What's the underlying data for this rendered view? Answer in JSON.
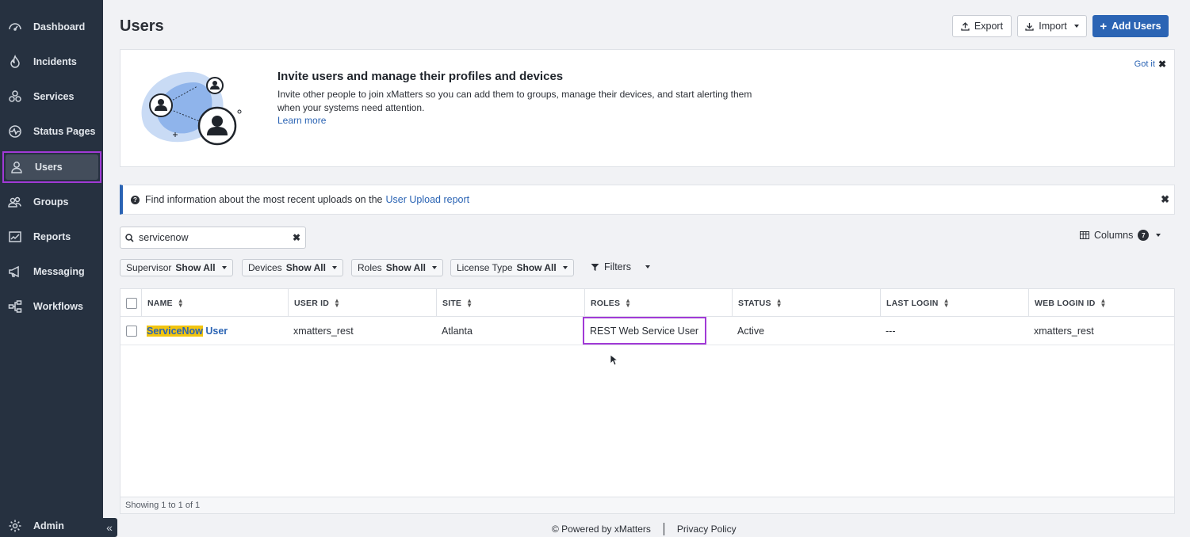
{
  "sidebar": {
    "items": [
      {
        "label": "Dashboard",
        "icon": "dashboard-icon"
      },
      {
        "label": "Incidents",
        "icon": "flame-icon"
      },
      {
        "label": "Services",
        "icon": "services-icon"
      },
      {
        "label": "Status Pages",
        "icon": "status-icon"
      },
      {
        "label": "Users",
        "icon": "user-icon",
        "active": true
      },
      {
        "label": "Groups",
        "icon": "groups-icon"
      },
      {
        "label": "Reports",
        "icon": "chart-icon"
      },
      {
        "label": "Messaging",
        "icon": "megaphone-icon"
      },
      {
        "label": "Workflows",
        "icon": "workflow-icon"
      }
    ],
    "admin_label": "Admin",
    "collapse_glyph": "«"
  },
  "header": {
    "title": "Users",
    "export_label": "Export",
    "import_label": "Import",
    "add_users_label": "Add Users"
  },
  "invite": {
    "title": "Invite users and manage their profiles and devices",
    "description": "Invite other people to join xMatters so you can add them to groups, manage their devices, and start alerting them when your systems need attention.",
    "learn_more": "Learn more",
    "got_it": "Got it"
  },
  "banner": {
    "text": "Find information about the most recent uploads on the",
    "link": "User Upload report"
  },
  "search": {
    "value": "servicenow",
    "placeholder": "Search"
  },
  "columns_label": "Columns",
  "columns_badge": "7",
  "filters": [
    {
      "label": "Supervisor",
      "value": "Show All"
    },
    {
      "label": "Devices",
      "value": "Show All"
    },
    {
      "label": "Roles",
      "value": "Show All"
    },
    {
      "label": "License Type",
      "value": "Show All"
    }
  ],
  "filters_label": "Filters",
  "table": {
    "headers": [
      "NAME",
      "USER ID",
      "SITE",
      "ROLES",
      "STATUS",
      "LAST LOGIN",
      "WEB LOGIN ID"
    ],
    "rows": [
      {
        "name_highlight": "ServiceNow",
        "name_rest": "User",
        "user_id": "xmatters_rest",
        "site": "Atlanta",
        "roles": "REST Web Service User",
        "status": "Active",
        "last_login": "---",
        "web_login_id": "xmatters_rest"
      }
    ],
    "footer": "Showing 1 to 1 of 1"
  },
  "footer": {
    "powered": "© Powered by xMatters",
    "privacy": "Privacy Policy"
  },
  "colors": {
    "sidebar_bg": "#263140",
    "accent": "#2b64b4",
    "highlight": "#f1c40f",
    "selection_outline": "#a13ad6"
  }
}
